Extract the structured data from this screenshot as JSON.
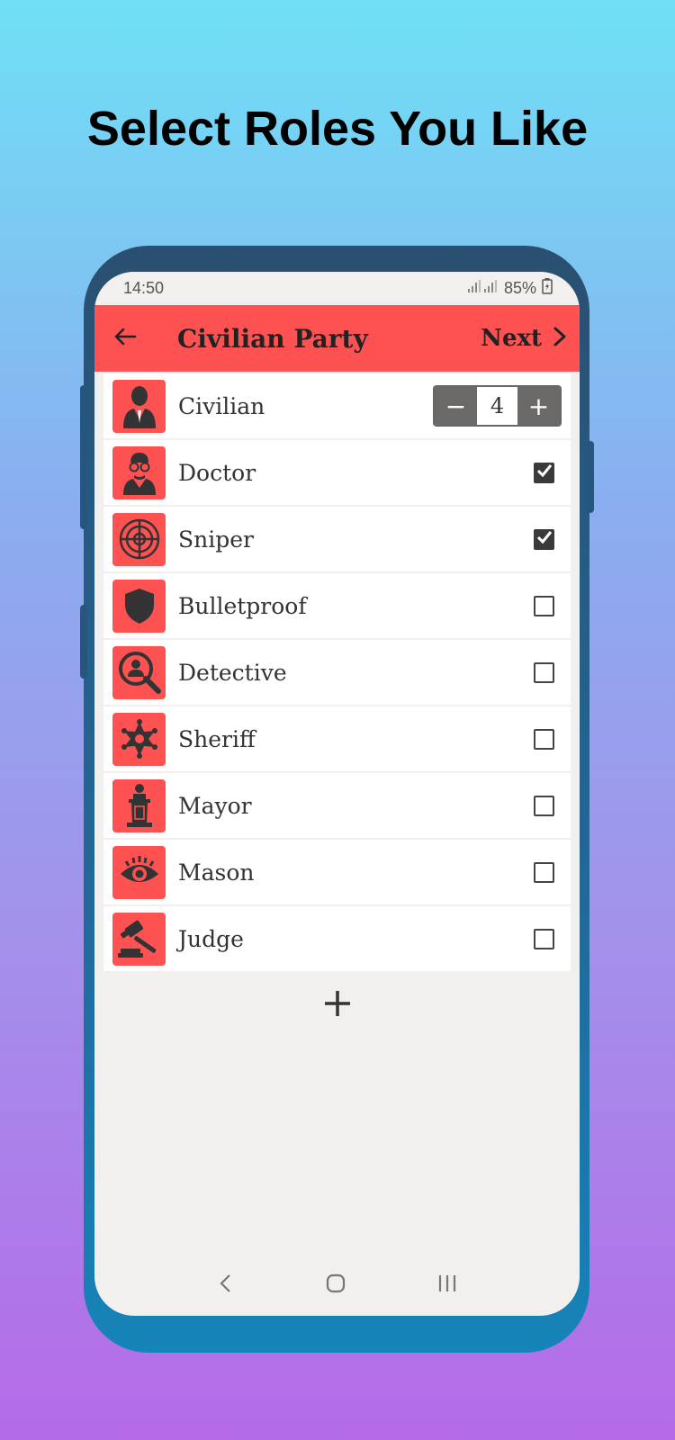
{
  "headline": "Select Roles You Like",
  "status_bar": {
    "time": "14:50",
    "battery": "85%"
  },
  "app_bar": {
    "title": "Civilian Party",
    "next_label": "Next"
  },
  "civilian": {
    "label": "Civilian",
    "count": "4",
    "minus": "−",
    "plus": "+"
  },
  "roles": [
    {
      "name": "Doctor",
      "checked": true,
      "icon": "doctor-icon"
    },
    {
      "name": "Sniper",
      "checked": true,
      "icon": "crosshair-icon"
    },
    {
      "name": "Bulletproof",
      "checked": false,
      "icon": "shield-icon"
    },
    {
      "name": "Detective",
      "checked": false,
      "icon": "magnifier-person-icon"
    },
    {
      "name": "Sheriff",
      "checked": false,
      "icon": "sheriff-star-icon"
    },
    {
      "name": "Mayor",
      "checked": false,
      "icon": "podium-icon"
    },
    {
      "name": "Mason",
      "checked": false,
      "icon": "eye-icon"
    },
    {
      "name": "Judge",
      "checked": false,
      "icon": "gavel-icon"
    }
  ],
  "colors": {
    "accent": "#fe5252",
    "screen_bg": "#f1f0ef",
    "icon_dark": "#333333"
  }
}
